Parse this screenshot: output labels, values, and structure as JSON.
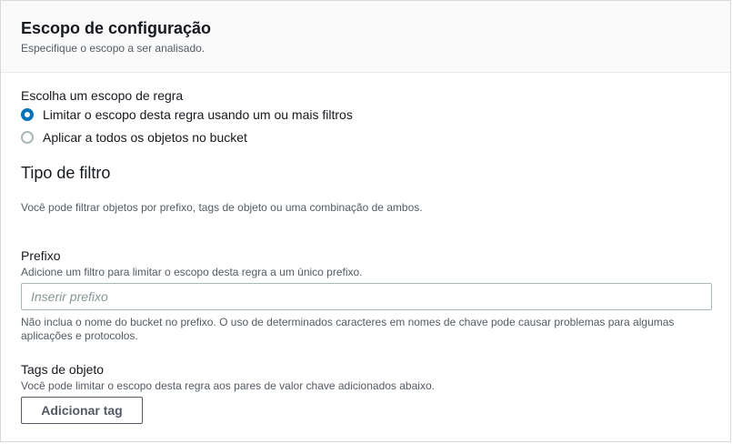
{
  "header": {
    "title": "Escopo de configuração",
    "description": "Especifique o escopo a ser analisado."
  },
  "rule_scope": {
    "label": "Escolha um escopo de regra",
    "options": [
      {
        "label": "Limitar o escopo desta regra usando um ou mais filtros",
        "selected": true
      },
      {
        "label": "Aplicar a todos os objetos no bucket",
        "selected": false
      }
    ]
  },
  "filter_type": {
    "title": "Tipo de filtro",
    "description": "Você pode filtrar objetos por prefixo, tags de objeto ou uma combinação de ambos."
  },
  "prefix": {
    "label": "Prefixo",
    "description": "Adicione um filtro para limitar o escopo desta regra a um único prefixo.",
    "value": "",
    "placeholder": "Inserir prefixo",
    "help": "Não inclua o nome do bucket no prefixo. O uso de determinados caracteres em nomes de chave pode causar problemas para algumas aplicações e protocolos."
  },
  "object_tags": {
    "label": "Tags de objeto",
    "description": "Você pode limitar o escopo desta regra aos pares de valor chave adicionados abaixo.",
    "add_button": "Adicionar tag"
  },
  "colors": {
    "accent": "#0073bb",
    "text": "#16191f",
    "secondary_text": "#545b64",
    "border": "#aab7b8",
    "header_bg": "#fafafa"
  }
}
